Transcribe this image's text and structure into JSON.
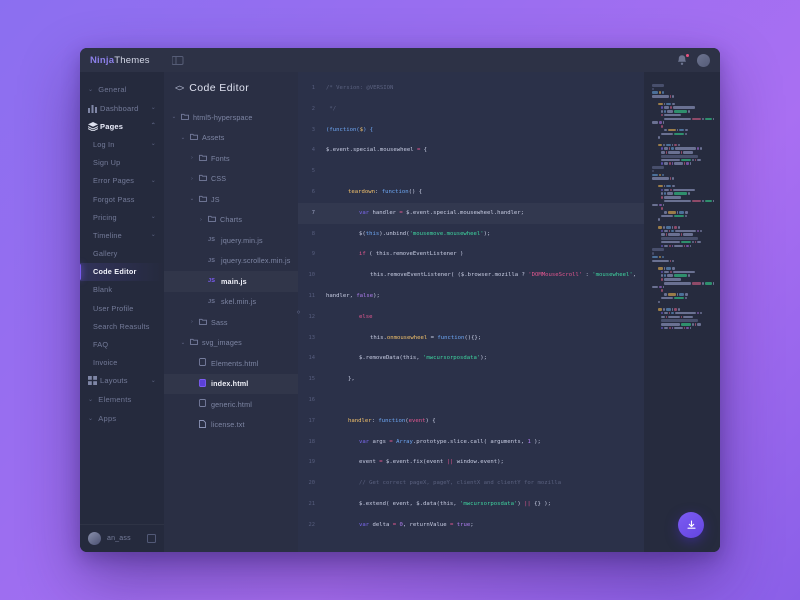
{
  "brand": {
    "part1": "Ninja",
    "part2": "Themes"
  },
  "titlebar": {
    "collapse_icon": "collapse-sidebar-icon",
    "bell_icon": "bell-icon",
    "avatar_icon": "user-avatar"
  },
  "sidebar": {
    "groups": [
      {
        "label": "General",
        "chev": "⌄"
      },
      {
        "label": "Elements",
        "chev": "⌄"
      },
      {
        "label": "Apps",
        "chev": "⌄"
      }
    ],
    "items": [
      {
        "label": "Dashboard",
        "icon": "chart-bar-icon",
        "caret": "⌄",
        "level": 0,
        "state": "normal"
      },
      {
        "label": "Pages",
        "icon": "layers-icon",
        "caret": "⌃",
        "level": 0,
        "state": "active-parent"
      },
      {
        "label": "Log In",
        "caret": "⌄",
        "level": 1,
        "state": "normal"
      },
      {
        "label": "Sign Up",
        "caret": "",
        "level": 1,
        "state": "normal"
      },
      {
        "label": "Error Pages",
        "caret": "⌄",
        "level": 1,
        "state": "normal"
      },
      {
        "label": "Forgot Pass",
        "caret": "",
        "level": 1,
        "state": "normal"
      },
      {
        "label": "Pricing",
        "caret": "⌄",
        "level": 1,
        "state": "normal"
      },
      {
        "label": "Timeline",
        "caret": "⌄",
        "level": 1,
        "state": "normal"
      },
      {
        "label": "Gallery",
        "caret": "",
        "level": 1,
        "state": "normal"
      },
      {
        "label": "Code Editor",
        "caret": "",
        "level": 1,
        "state": "current"
      },
      {
        "label": "Blank",
        "caret": "",
        "level": 1,
        "state": "normal"
      },
      {
        "label": "User Profile",
        "caret": "",
        "level": 1,
        "state": "normal"
      },
      {
        "label": "Search Reasults",
        "caret": "",
        "level": 1,
        "state": "normal"
      },
      {
        "label": "FAQ",
        "caret": "",
        "level": 1,
        "state": "normal"
      },
      {
        "label": "Invoice",
        "caret": "",
        "level": 1,
        "state": "normal"
      },
      {
        "label": "Layouts",
        "icon": "grid-icon",
        "caret": "⌄",
        "level": 0,
        "state": "normal"
      }
    ],
    "footer": {
      "user": "an_ass",
      "logout_icon": "logout-icon"
    }
  },
  "filepanel": {
    "title": "Code Editor",
    "title_icon": "code-brackets-icon",
    "splitter_icon": "resize-handle-icon",
    "tree": [
      {
        "label": "html5-hyperspace",
        "type": "folder",
        "arrow": "⌄",
        "indent": 0,
        "state": "normal"
      },
      {
        "label": "Assets",
        "type": "folder",
        "arrow": "⌄",
        "indent": 1,
        "state": "normal"
      },
      {
        "label": "Fonts",
        "type": "folder",
        "arrow": "›",
        "indent": 2,
        "state": "normal"
      },
      {
        "label": "CSS",
        "type": "folder",
        "arrow": "›",
        "indent": 2,
        "state": "normal"
      },
      {
        "label": "JS",
        "type": "folder",
        "arrow": "⌄",
        "indent": 2,
        "state": "normal"
      },
      {
        "label": "Charts",
        "type": "folder",
        "arrow": "›",
        "indent": 3,
        "state": "normal"
      },
      {
        "label": "jquery.min.js",
        "type": "js",
        "arrow": "",
        "indent": 3,
        "state": "normal"
      },
      {
        "label": "jquery.scrollex.min.js",
        "type": "js",
        "arrow": "",
        "indent": 3,
        "state": "normal"
      },
      {
        "label": "main.js",
        "type": "js",
        "arrow": "",
        "indent": 3,
        "state": "selected"
      },
      {
        "label": "skel.min.js",
        "type": "js",
        "arrow": "",
        "indent": 3,
        "state": "normal"
      },
      {
        "label": "Sass",
        "type": "folder",
        "arrow": "›",
        "indent": 2,
        "state": "normal"
      },
      {
        "label": "svg_images",
        "type": "folder",
        "arrow": "⌄",
        "indent": 1,
        "state": "normal"
      },
      {
        "label": "Elements.html",
        "type": "html",
        "arrow": "",
        "indent": 2,
        "state": "normal"
      },
      {
        "label": "index.html",
        "type": "html-active",
        "arrow": "",
        "indent": 2,
        "state": "selected"
      },
      {
        "label": "generic.html",
        "type": "html",
        "arrow": "",
        "indent": 2,
        "state": "normal"
      },
      {
        "label": "license.txt",
        "type": "txt",
        "arrow": "",
        "indent": 2,
        "state": "normal"
      }
    ]
  },
  "editor": {
    "highlight_line": 7,
    "line_numbers": [
      1,
      2,
      3,
      4,
      5,
      6,
      7,
      8,
      9,
      10,
      11,
      12,
      13,
      14,
      15,
      16,
      17,
      18,
      19,
      20,
      21,
      22
    ],
    "lines": [
      {
        "n": 1,
        "indent": 0,
        "tokens": [
          [
            "cm",
            "/* Version: @VERSION"
          ]
        ]
      },
      {
        "n": 2,
        "indent": 0,
        "tokens": [
          [
            "cm",
            " */"
          ]
        ]
      },
      {
        "n": 3,
        "indent": 0,
        "tokens": [
          [
            "bl",
            "(function("
          ],
          [
            "fn",
            "$"
          ],
          [
            "bl",
            ") {"
          ]
        ]
      },
      {
        "n": 4,
        "indent": 0,
        "tokens": [
          [
            "id",
            "$.event.special.mousewheel "
          ],
          [
            "op",
            "="
          ],
          [
            "id",
            " {"
          ]
        ]
      },
      {
        "n": 5,
        "indent": 0,
        "tokens": [
          [
            "id",
            ""
          ]
        ]
      },
      {
        "n": 6,
        "indent": 2,
        "tokens": [
          [
            "fn",
            "teardown"
          ],
          [
            "id",
            ": "
          ],
          [
            "bl",
            "function"
          ],
          [
            "id",
            "() {"
          ]
        ]
      },
      {
        "n": 7,
        "indent": 3,
        "tokens": [
          [
            "va",
            "var"
          ],
          [
            "id",
            " handler "
          ],
          [
            "op",
            "="
          ],
          [
            "id",
            " $.event.special.mousewheel.handler;"
          ]
        ]
      },
      {
        "n": 8,
        "indent": 3,
        "tokens": [
          [
            "id",
            "$("
          ],
          [
            "bl",
            "this"
          ],
          [
            "id",
            ").unbind("
          ],
          [
            "st",
            "'mousemove.mousewheel'"
          ],
          [
            "id",
            ");"
          ]
        ]
      },
      {
        "n": 9,
        "indent": 3,
        "tokens": [
          [
            "kw",
            "if"
          ],
          [
            "id",
            " ( this.removeEventListener )"
          ]
        ]
      },
      {
        "n": 10,
        "indent": 4,
        "tokens": [
          [
            "id",
            "this.removeEventListener( ($.browser.mozilla ? "
          ],
          [
            "op",
            "'DOMMouseScroll'"
          ],
          [
            "id",
            " : "
          ],
          [
            "st",
            "'mousewheel'"
          ],
          [
            "id",
            ","
          ]
        ]
      },
      {
        "n": 11,
        "indent": 0,
        "tokens": [
          [
            "id",
            "handler, "
          ],
          [
            "nu",
            "false"
          ],
          [
            "id",
            ");"
          ]
        ]
      },
      {
        "n": 12,
        "indent": 3,
        "tokens": [
          [
            "kw",
            "else"
          ]
        ]
      },
      {
        "n": 13,
        "indent": 4,
        "tokens": [
          [
            "id",
            "this."
          ],
          [
            "fn",
            "onmousewheel"
          ],
          [
            "id",
            " = "
          ],
          [
            "bl",
            "function"
          ],
          [
            "id",
            "(){};"
          ]
        ]
      },
      {
        "n": 14,
        "indent": 3,
        "tokens": [
          [
            "id",
            "$.removeData(this, "
          ],
          [
            "st",
            "'mwcursorposdata'"
          ],
          [
            "id",
            ");"
          ]
        ]
      },
      {
        "n": 15,
        "indent": 2,
        "tokens": [
          [
            "id",
            "},"
          ]
        ]
      },
      {
        "n": 16,
        "indent": 0,
        "tokens": [
          [
            "id",
            ""
          ]
        ]
      },
      {
        "n": 17,
        "indent": 2,
        "tokens": [
          [
            "fn",
            "handler"
          ],
          [
            "id",
            ": "
          ],
          [
            "bl",
            "function"
          ],
          [
            "id",
            "("
          ],
          [
            "op",
            "event"
          ],
          [
            "id",
            ") {"
          ]
        ]
      },
      {
        "n": 18,
        "indent": 3,
        "tokens": [
          [
            "va",
            "var"
          ],
          [
            "id",
            " args "
          ],
          [
            "op",
            "="
          ],
          [
            "id",
            " "
          ],
          [
            "bl",
            "Array"
          ],
          [
            "id",
            ".prototype.slice.call( arguments, "
          ],
          [
            "nu",
            "1"
          ],
          [
            "id",
            " );"
          ]
        ]
      },
      {
        "n": 19,
        "indent": 3,
        "tokens": [
          [
            "id",
            "event "
          ],
          [
            "op",
            "="
          ],
          [
            "id",
            " $.event.fix(event "
          ],
          [
            "op",
            "||"
          ],
          [
            "id",
            " window.event);"
          ]
        ]
      },
      {
        "n": 20,
        "indent": 3,
        "tokens": [
          [
            "cm",
            "// Get correct pageX, pageY, clientX and clientY for mozilla"
          ]
        ]
      },
      {
        "n": 21,
        "indent": 3,
        "tokens": [
          [
            "id",
            "$.extend( event, $.data(this, "
          ],
          [
            "st",
            "'mwcursorposdata'"
          ],
          [
            "id",
            ") "
          ],
          [
            "op",
            "||"
          ],
          [
            "id",
            " {} );"
          ]
        ]
      },
      {
        "n": 22,
        "indent": 3,
        "tokens": [
          [
            "va",
            "var"
          ],
          [
            "id",
            " delta "
          ],
          [
            "op",
            "="
          ],
          [
            "id",
            " "
          ],
          [
            "nu",
            "0"
          ],
          [
            "id",
            ", returnValue "
          ],
          [
            "op",
            "="
          ],
          [
            "id",
            " "
          ],
          [
            "nu",
            "true"
          ],
          [
            "id",
            ";"
          ]
        ]
      }
    ]
  },
  "minimap": {
    "name": "code-minimap"
  },
  "fab": {
    "icon": "download-icon",
    "color": "#7d5cf3"
  },
  "theme": {
    "background_gradient_start": "#8b6ff0",
    "background_gradient_end": "#8a5fe8",
    "window_bg": "#262b3e",
    "sidebar_bg": "#252a3d",
    "filepanel_bg": "#2a2f44",
    "editor_bg": "#2b3149",
    "accent": "#7a5cf0",
    "badge": "#e8527f"
  }
}
